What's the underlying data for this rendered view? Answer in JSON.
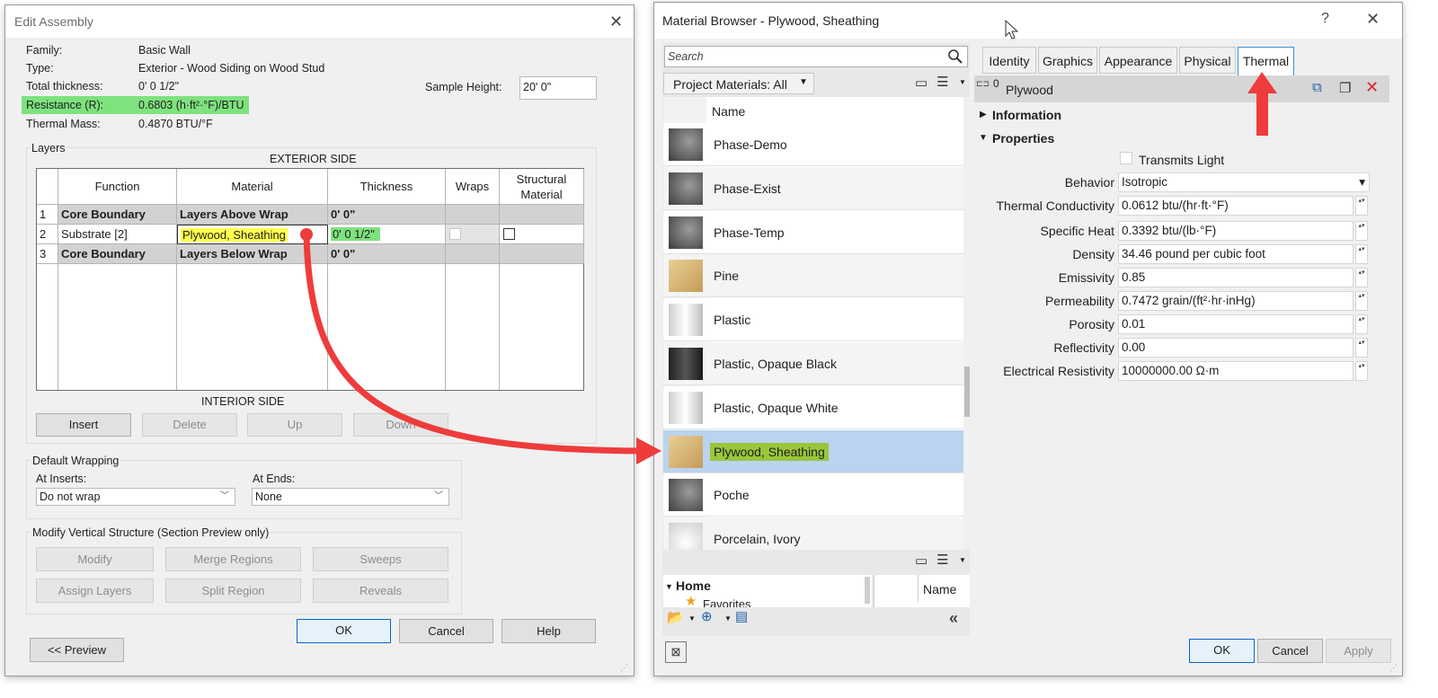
{
  "edit_assembly": {
    "title": "Edit Assembly",
    "close_glyph": "✕",
    "info": [
      {
        "label": "Family:",
        "value": "Basic Wall"
      },
      {
        "label": "Type:",
        "value": "Exterior - Wood Siding on Wood Stud"
      },
      {
        "label": "Total thickness:",
        "value": "0'  0 1/2\""
      },
      {
        "label": "Resistance (R):",
        "value": "0.6803 (h·ft²·°F)/BTU"
      },
      {
        "label": "Thermal Mass:",
        "value": "0.4870 BTU/°F"
      }
    ],
    "sample_height_label": "Sample Height:",
    "sample_height_value": "20'  0\"",
    "layers_group": "Layers",
    "exterior_side": "EXTERIOR SIDE",
    "interior_side": "INTERIOR SIDE",
    "columns": {
      "function": "Function",
      "material": "Material",
      "thickness": "Thickness",
      "wraps": "Wraps",
      "structural_1": "Structural",
      "structural_2": "Material"
    },
    "rows": [
      {
        "num": "1",
        "function": "Core Boundary",
        "material": "Layers Above Wrap",
        "thickness": "0'  0\""
      },
      {
        "num": "2",
        "function": "Substrate [2]",
        "material": "Plywood, Sheathing",
        "thickness": "0'  0 1/2\""
      },
      {
        "num": "3",
        "function": "Core Boundary",
        "material": "Layers Below Wrap",
        "thickness": "0'  0\""
      }
    ],
    "layer_buttons": {
      "insert": "Insert",
      "delete": "Delete",
      "up": "Up",
      "down": "Down"
    },
    "default_wrapping": "Default Wrapping",
    "at_inserts_label": "At Inserts:",
    "at_inserts_value": "Do not wrap",
    "at_ends_label": "At  Ends:",
    "at_ends_value": "None",
    "modify_group": "Modify Vertical Structure (Section Preview only)",
    "modify_buttons": {
      "modify": "Modify",
      "merge": "Merge Regions",
      "sweeps": "Sweeps",
      "assign": "Assign Layers",
      "split": "Split Region",
      "reveals": "Reveals"
    },
    "footer": {
      "ok": "OK",
      "cancel": "Cancel",
      "help": "Help",
      "preview": "<< Preview"
    }
  },
  "material_browser": {
    "title": "Material Browser - Plywood, Sheathing",
    "help_glyph": "?",
    "close_glyph": "✕",
    "search_placeholder": "Search",
    "project_materials": "Project Materials: All",
    "list_header": "Name",
    "materials": [
      {
        "name": "Phase-Demo",
        "thumb": "sphere-dark"
      },
      {
        "name": "Phase-Exist",
        "thumb": "sphere-dark"
      },
      {
        "name": "Phase-Temp",
        "thumb": "sphere-dark"
      },
      {
        "name": "Pine",
        "thumb": "wood-cube"
      },
      {
        "name": "Plastic",
        "thumb": "cylinder-light"
      },
      {
        "name": "Plastic, Opaque Black",
        "thumb": "cylinder-black"
      },
      {
        "name": "Plastic, Opaque White",
        "thumb": "cylinder-white"
      },
      {
        "name": "Plywood, Sheathing",
        "thumb": "wood-cube"
      },
      {
        "name": "Poche",
        "thumb": "sphere-dark"
      },
      {
        "name": "Porcelain, Ivory",
        "thumb": "bowl-white"
      }
    ],
    "library": {
      "home": "Home",
      "favorites": "Favorites",
      "name_col": "Name"
    },
    "tabs": [
      "Identity",
      "Graphics",
      "Appearance",
      "Physical",
      "Thermal"
    ],
    "asset_name": "Plywood",
    "asset_count": "0",
    "sections": {
      "information": "Information",
      "properties": "Properties"
    },
    "transmits_light": "Transmits Light",
    "properties": [
      {
        "label": "Behavior",
        "value": "Isotropic"
      },
      {
        "label": "Thermal Conductivity",
        "value": "0.0612 btu/(hr·ft·°F)"
      },
      {
        "label": "Specific Heat",
        "value": "0.3392 btu/(lb·°F)"
      },
      {
        "label": "Density",
        "value": "34.46 pound per cubic foot"
      },
      {
        "label": "Emissivity",
        "value": "0.85"
      },
      {
        "label": "Permeability",
        "value": "0.7472 grain/(ft²·hr·inHg)"
      },
      {
        "label": "Porosity",
        "value": "0.01"
      },
      {
        "label": "Reflectivity",
        "value": "0.00"
      },
      {
        "label": "Electrical Resistivity",
        "value": "10000000.00 Ω·m"
      }
    ],
    "footer": {
      "ok": "OK",
      "cancel": "Cancel",
      "apply": "Apply"
    }
  },
  "colors": {
    "highlight_green": "#7ee27e",
    "highlight_yellow": "#ffff4d",
    "selected_row": "#b9d3f0",
    "annotation_red": "#ee3c3c",
    "accent_blue": "#3c8fd4"
  }
}
